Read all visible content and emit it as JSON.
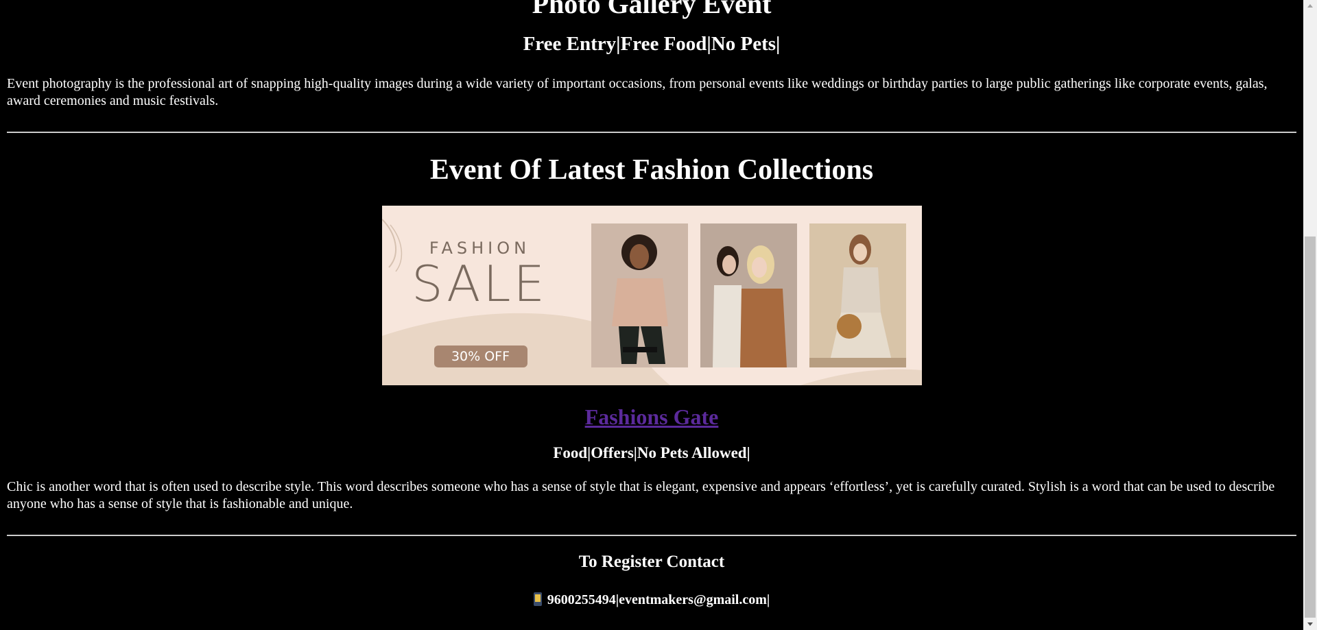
{
  "event1": {
    "title": "Photo Gallery Event",
    "tags": "Free Entry|Free Food|No Pets|",
    "description": "Event photography is the professional art of snapping high-quality images during a wide variety of important occasions, from personal events like weddings or birthday parties to large public gatherings like corporate events, galas, award ceremonies and music festivals."
  },
  "event2": {
    "title": "Event Of Latest Fashion Collections",
    "banner": {
      "fashion_text": "FASHION",
      "sale_text": "SALE",
      "discount_text": "30% OFF"
    },
    "link_text": "Fashions Gate",
    "tags": "Food|Offers|No Pets Allowed|",
    "description": "Chic is another word that is often used to describe style. This word describes someone who has a sense of style that is elegant, expensive and appears ‘effortless’, yet is carefully curated. Stylish is a word that can be used to describe anyone who has a sense of style that is fashionable and unique."
  },
  "contact": {
    "heading": "To Register Contact",
    "details": "9600255494|eventmakers@gmail.com|",
    "icon": "mobile-phone-icon"
  },
  "colors": {
    "background": "#000000",
    "text": "#ffffff",
    "link": "#5b2a9b",
    "banner_bg": "#f7e6dc"
  }
}
